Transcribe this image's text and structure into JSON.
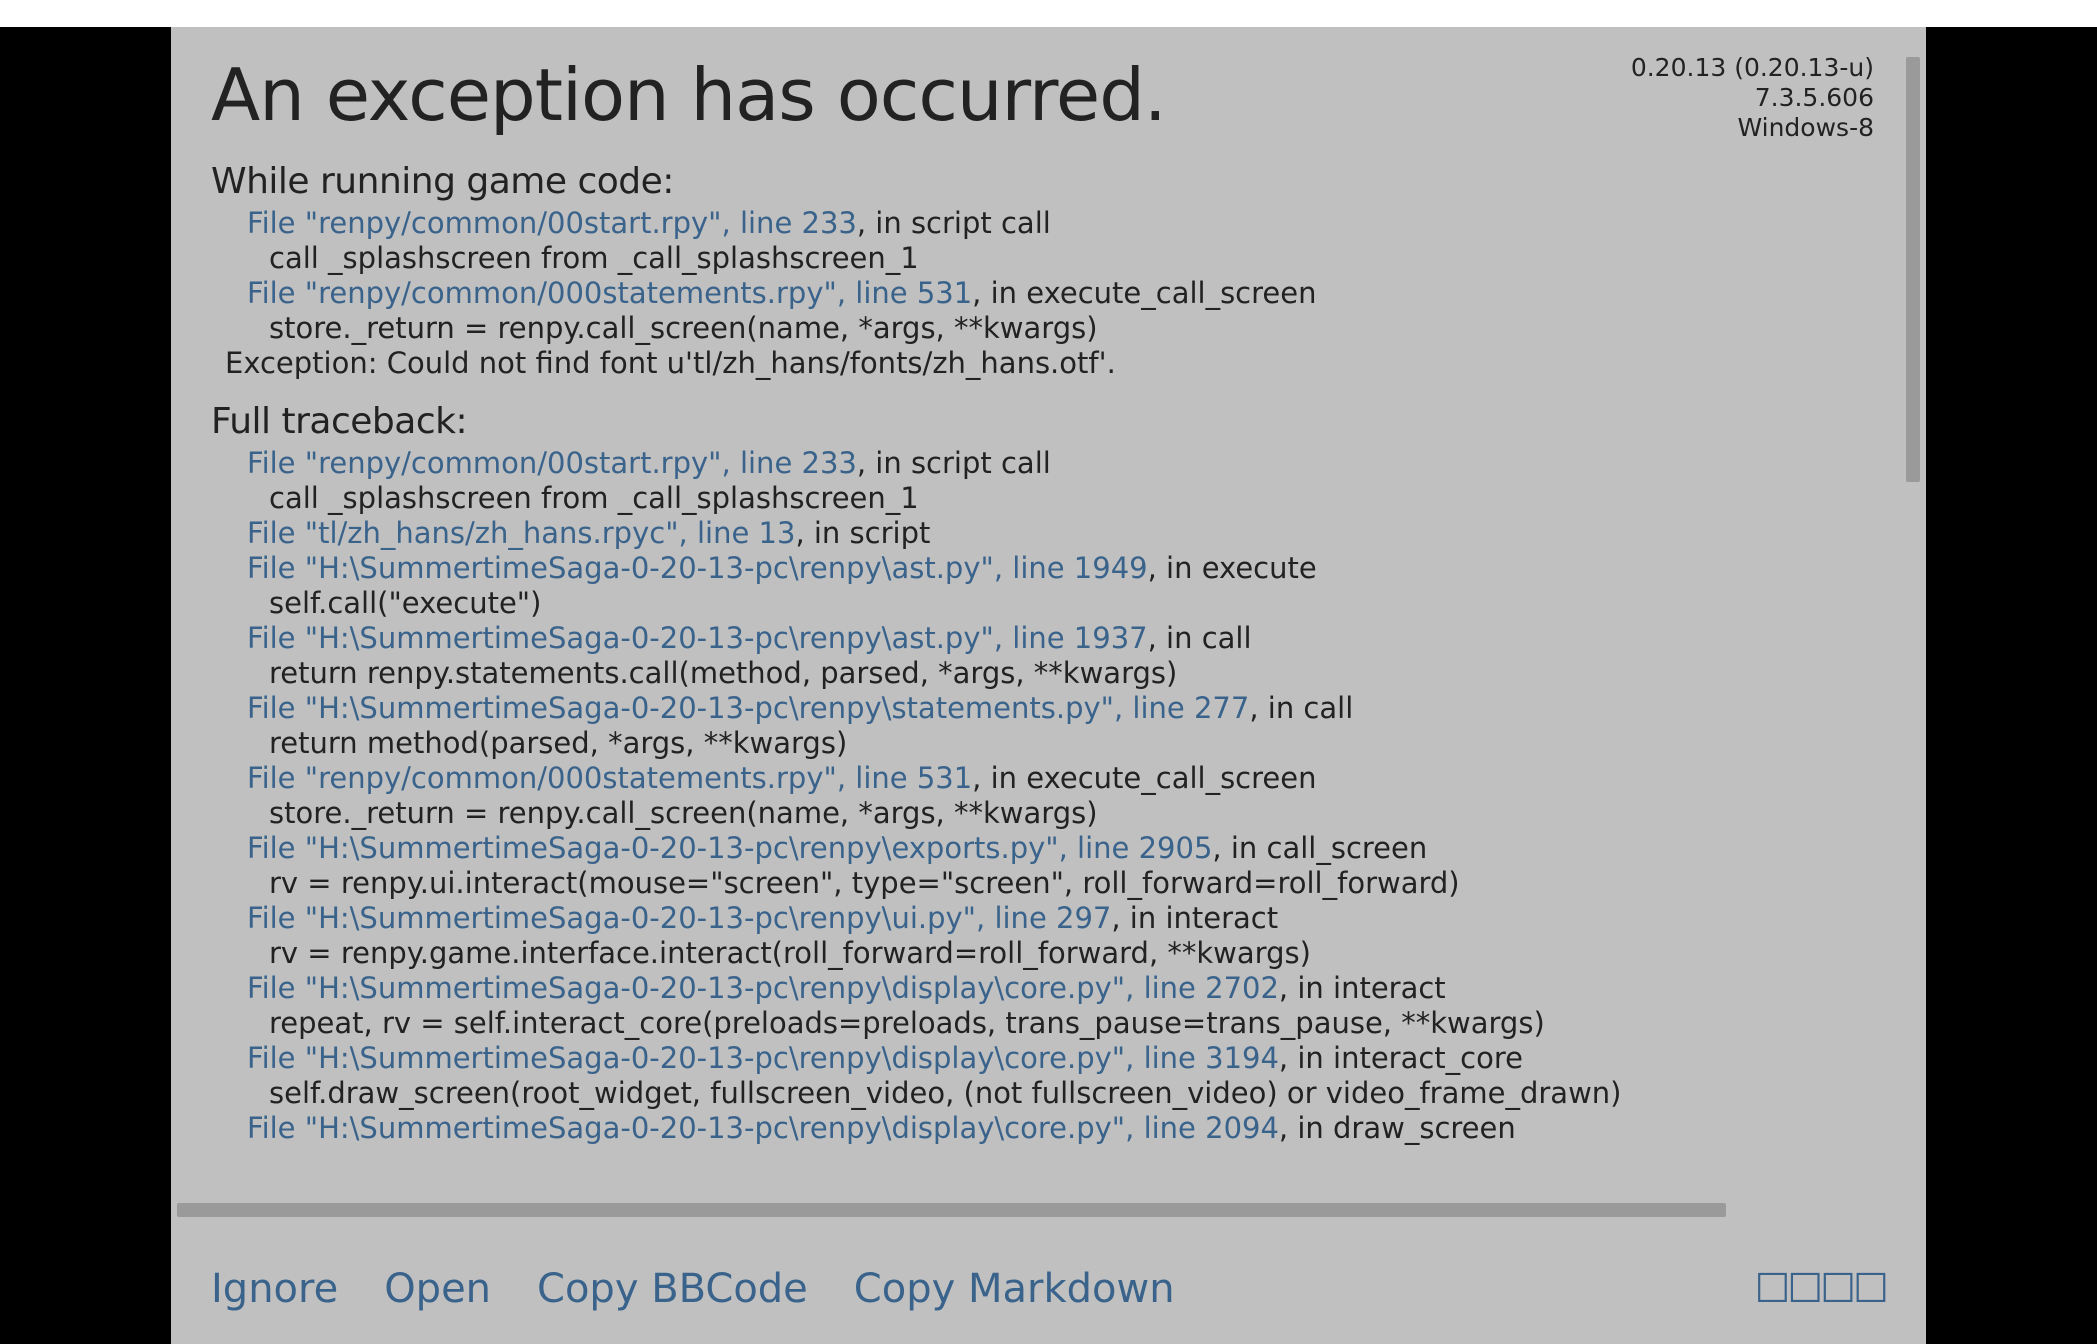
{
  "title": "An exception has occurred.",
  "version": {
    "game": "0.20.13 (0.20.13-u)",
    "renpy": "7.3.5.606",
    "os": "Windows-8"
  },
  "sections": {
    "running": "While running game code:",
    "full": "Full traceback:"
  },
  "running_tb": [
    {
      "file": "File \"renpy/common/00start.rpy\", line 233",
      "ctx": ", in script call",
      "code": "call _splashscreen from _call_splashscreen_1"
    },
    {
      "file": "File \"renpy/common/000statements.rpy\", line 531",
      "ctx": ", in execute_call_screen",
      "code": "store._return = renpy.call_screen(name, *args, **kwargs)"
    }
  ],
  "exception_line": "Exception: Could not find font u'tl/zh_hans/fonts/zh_hans.otf'.",
  "full_tb": [
    {
      "file": "File \"renpy/common/00start.rpy\", line 233",
      "ctx": ", in script call",
      "code": "call _splashscreen from _call_splashscreen_1"
    },
    {
      "file": "File \"tl/zh_hans/zh_hans.rpyc\", line 13",
      "ctx": ", in script",
      "code": ""
    },
    {
      "file": "File \"H:\\SummertimeSaga-0-20-13-pc\\renpy\\ast.py\", line 1949",
      "ctx": ", in execute",
      "code": "self.call(\"execute\")"
    },
    {
      "file": "File \"H:\\SummertimeSaga-0-20-13-pc\\renpy\\ast.py\", line 1937",
      "ctx": ", in call",
      "code": "return renpy.statements.call(method, parsed, *args, **kwargs)"
    },
    {
      "file": "File \"H:\\SummertimeSaga-0-20-13-pc\\renpy\\statements.py\", line 277",
      "ctx": ", in call",
      "code": "return method(parsed, *args, **kwargs)"
    },
    {
      "file": "File \"renpy/common/000statements.rpy\", line 531",
      "ctx": ", in execute_call_screen",
      "code": "store._return = renpy.call_screen(name, *args, **kwargs)"
    },
    {
      "file": "File \"H:\\SummertimeSaga-0-20-13-pc\\renpy\\exports.py\", line 2905",
      "ctx": ", in call_screen",
      "code": "rv = renpy.ui.interact(mouse=\"screen\", type=\"screen\", roll_forward=roll_forward)"
    },
    {
      "file": "File \"H:\\SummertimeSaga-0-20-13-pc\\renpy\\ui.py\", line 297",
      "ctx": ", in interact",
      "code": "rv = renpy.game.interface.interact(roll_forward=roll_forward, **kwargs)"
    },
    {
      "file": "File \"H:\\SummertimeSaga-0-20-13-pc\\renpy\\display\\core.py\", line 2702",
      "ctx": ", in interact",
      "code": "repeat, rv = self.interact_core(preloads=preloads, trans_pause=trans_pause, **kwargs)"
    },
    {
      "file": "File \"H:\\SummertimeSaga-0-20-13-pc\\renpy\\display\\core.py\", line 3194",
      "ctx": ", in interact_core",
      "code": "self.draw_screen(root_widget, fullscreen_video, (not fullscreen_video) or video_frame_drawn)"
    },
    {
      "file": "File \"H:\\SummertimeSaga-0-20-13-pc\\renpy\\display\\core.py\", line 2094",
      "ctx": ", in draw_screen",
      "code": ""
    }
  ],
  "buttons": {
    "ignore": "Ignore",
    "open": "Open",
    "copy_bbcode": "Copy BBCode",
    "copy_markdown": "Copy Markdown",
    "glyphs": "☐☐☐☐"
  }
}
